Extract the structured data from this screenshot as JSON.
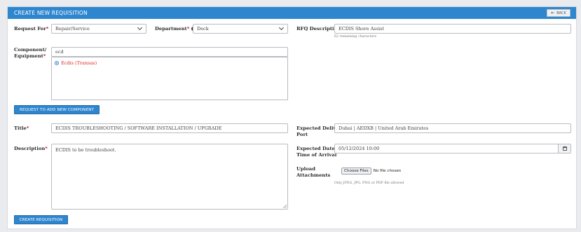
{
  "header": {
    "title": "CREATE NEW REQUISITION",
    "back_label": "BACK",
    "back_icon": "arrow-left-icon"
  },
  "request_for": {
    "label": "Request For",
    "value": "Repair/Service"
  },
  "department": {
    "label": "Department",
    "value": "Deck",
    "info_icon": "info-circle-icon"
  },
  "rfq": {
    "label": "RFQ Description",
    "value": "ECDIS Shore Assist",
    "hint": "62 remaining characters"
  },
  "component": {
    "label_line1": "Component/",
    "label_line2": "Equipment",
    "search_value": "ecd",
    "options": [
      {
        "label": "Ecdis (Transas)",
        "selected": true
      }
    ]
  },
  "add_component_button": "REQUEST TO ADD NEW COMPONENT",
  "title": {
    "label": "Title",
    "value": "ECDIS TROUBLESHOOTING / SOFTWARE INSTALLATION / UPGRADE"
  },
  "delivery_port": {
    "label_line1": "Expected Delivery",
    "label_line2": "Port",
    "value": "Dubai | AEDXB | United Arab Emirates"
  },
  "description": {
    "label": "Description",
    "value": "ECDIS to be troubleshoot."
  },
  "arrival": {
    "label_line1": "Expected Date &",
    "label_line2": "Time of Arrival",
    "value": "05/12/2024 10:00",
    "icon": "calendar-icon"
  },
  "upload": {
    "label_line1": "Upload",
    "label_line2": "Attachments",
    "button": "Choose Files",
    "status": "No file chosen",
    "hint": "Only JPEG, JPG, PNG or PDF file allowed"
  },
  "create_button": "CREATE REQUISITION",
  "colors": {
    "primary": "#2e86cf",
    "required": "#d0021b",
    "option_text": "#e02424"
  }
}
